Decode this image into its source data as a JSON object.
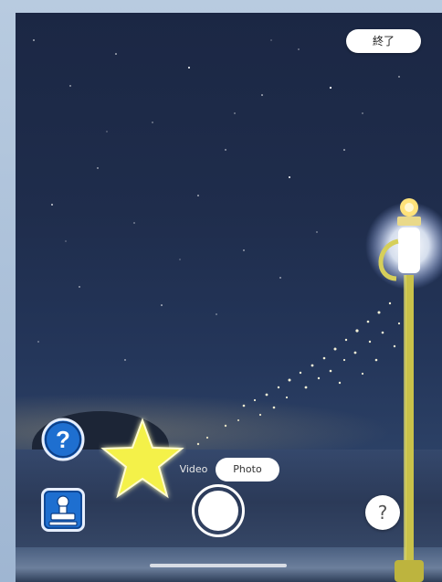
{
  "camera": {
    "end_label": "終了",
    "modes": [
      {
        "label": "Video",
        "selected": false
      },
      {
        "label": "Photo",
        "selected": true
      }
    ]
  },
  "icons": {
    "help_blue": "question-mark-icon",
    "stamp_blue": "stamp-icon",
    "star_effect": "star-icon",
    "help_small": "question-mark-icon"
  },
  "help_small_label": "?",
  "colors": {
    "accent_blue": "#1e6fd0",
    "star_yellow": "#f4f14a",
    "button_white": "#ffffff"
  }
}
